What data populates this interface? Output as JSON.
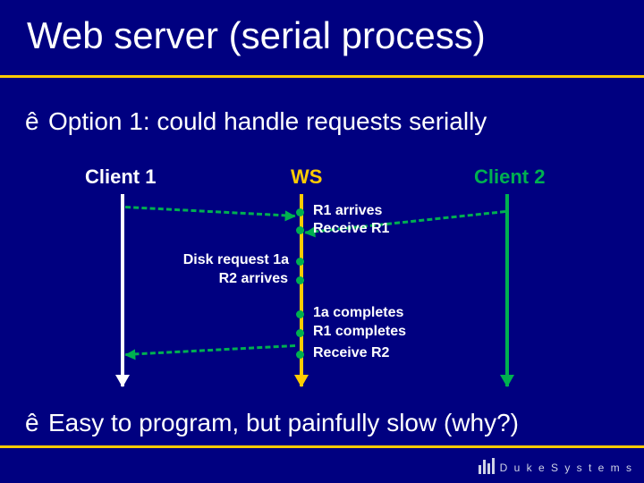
{
  "title": "Web server (serial process)",
  "bullets": {
    "b1_marker": "ê",
    "b1_text": "Option 1: could handle requests serially",
    "b2_marker": "ê",
    "b2_text": "Easy to program, but painfully slow (why?)"
  },
  "timeline": {
    "client1": "Client 1",
    "ws": "WS",
    "client2": "Client 2",
    "events": {
      "r1_arrives": "R1 arrives",
      "receive_r1": "Receive R1",
      "disk_req_1a": "Disk request 1a",
      "r2_arrives": "R2 arrives",
      "oa_completes": "1a completes",
      "r1_completes": "R1 completes",
      "receive_r2": "Receive R2"
    }
  },
  "footer": {
    "logo_text": "D u k e   S y s t e m s"
  }
}
